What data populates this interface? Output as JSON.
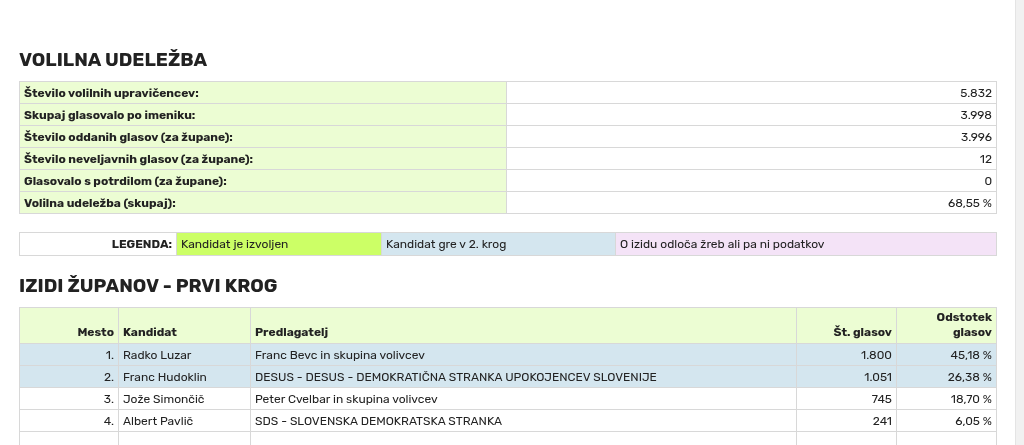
{
  "turnout": {
    "title": "VOLILNA UDELEŽBA",
    "rows": [
      {
        "label": "Število volilnih upravičencev:",
        "value": "5.832"
      },
      {
        "label": "Skupaj glasovalo po imeniku:",
        "value": "3.998"
      },
      {
        "label": "Število oddanih glasov (za župane):",
        "value": "3.996"
      },
      {
        "label": "Število neveljavnih glasov (za župane):",
        "value": "12"
      },
      {
        "label": "Glasovalo s potrdilom (za župane):",
        "value": "0"
      },
      {
        "label": "Volilna udeležba (skupaj):",
        "value": "68,55 %"
      }
    ]
  },
  "legend": {
    "label": "LEGENDA:",
    "items": [
      {
        "kind": "elected",
        "text": "Kandidat je izvoljen"
      },
      {
        "kind": "runoff",
        "text": "Kandidat gre v 2. krog"
      },
      {
        "kind": "undecided",
        "text": "O izidu odloča žreb ali pa ni podatkov"
      }
    ]
  },
  "results": {
    "title": "IZIDI ŽUPANOV - PRVI KROG",
    "columns": [
      "Mesto",
      "Kandidat",
      "Predlagatelj",
      "Št. glasov",
      "Odstotek glasov"
    ],
    "rows": [
      {
        "runoff": true,
        "place": "1.",
        "candidate": "Radko Luzar",
        "proposer": "Franc Bevc in skupina volivcev",
        "votes": "1.800",
        "percent": "45,18 %"
      },
      {
        "runoff": true,
        "place": "2.",
        "candidate": "Franc Hudoklin",
        "proposer": "DESUS - DESUS - DEMOKRATIČNA STRANKA UPOKOJENCEV SLOVENIJE",
        "votes": "1.051",
        "percent": "26,38 %"
      },
      {
        "runoff": false,
        "place": "3.",
        "candidate": "Jože Simončič",
        "proposer": "Peter Cvelbar in skupina volivcev",
        "votes": "745",
        "percent": "18,70 %"
      },
      {
        "runoff": false,
        "place": "4.",
        "candidate": "Albert Pavlič",
        "proposer": "SDS - SLOVENSKA DEMOKRATSKA STRANKA",
        "votes": "241",
        "percent": "6,05 %"
      }
    ]
  }
}
